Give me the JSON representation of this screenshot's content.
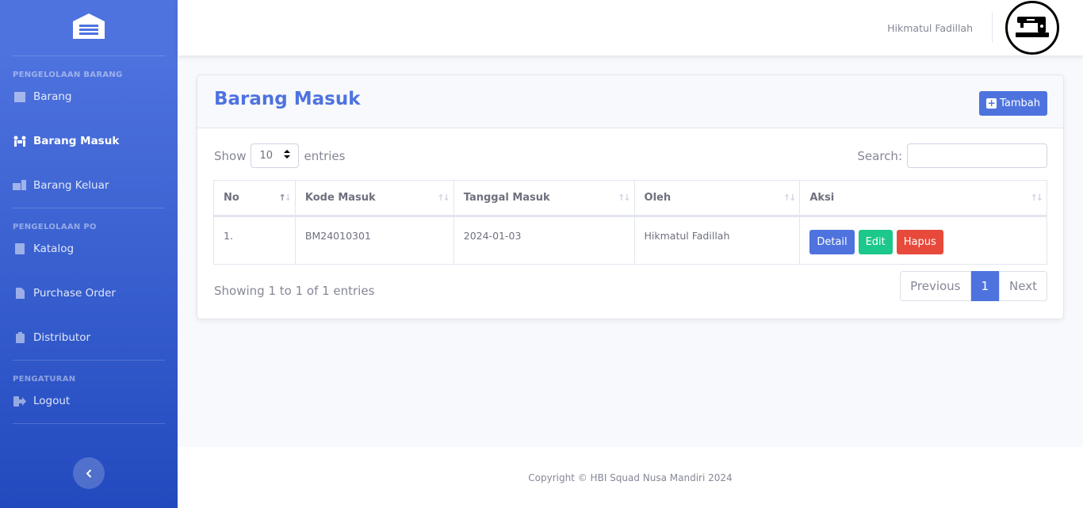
{
  "sidebar": {
    "sections": [
      {
        "heading": "PENGELOLAAN BARANG"
      },
      {
        "heading": "PENGELOLAAN PO"
      },
      {
        "heading": "PENGATURAN"
      }
    ],
    "items": {
      "barang": "Barang",
      "barang_masuk": "Barang Masuk",
      "barang_keluar": "Barang Keluar",
      "katalog": "Katalog",
      "purchase_order": "Purchase Order",
      "distributor": "Distributor",
      "logout": "Logout"
    }
  },
  "topbar": {
    "username": "Hikmatul Fadillah"
  },
  "card": {
    "title": "Barang Masuk",
    "add_label": "Tambah",
    "show_label": "Show",
    "entries_value": "10",
    "entries_label": "entries",
    "search_label": "Search:",
    "search_value": ""
  },
  "table": {
    "columns": [
      "No",
      "Kode Masuk",
      "Tanggal Masuk",
      "Oleh",
      "Aksi"
    ],
    "rows": [
      {
        "no": "1.",
        "kode": "BM24010301",
        "tanggal": "2024-01-03",
        "oleh": "Hikmatul Fadillah"
      }
    ],
    "actions": {
      "detail": "Detail",
      "edit": "Edit",
      "hapus": "Hapus"
    }
  },
  "pagination": {
    "info": "Showing 1 to 1 of 1 entries",
    "previous": "Previous",
    "current": "1",
    "next": "Next"
  },
  "footer": {
    "copyright": "Copyright © HBI Squad Nusa Mandiri 2024"
  },
  "colors": {
    "primary": "#4e73df",
    "success": "#1cc88a",
    "danger": "#e74a3b"
  }
}
